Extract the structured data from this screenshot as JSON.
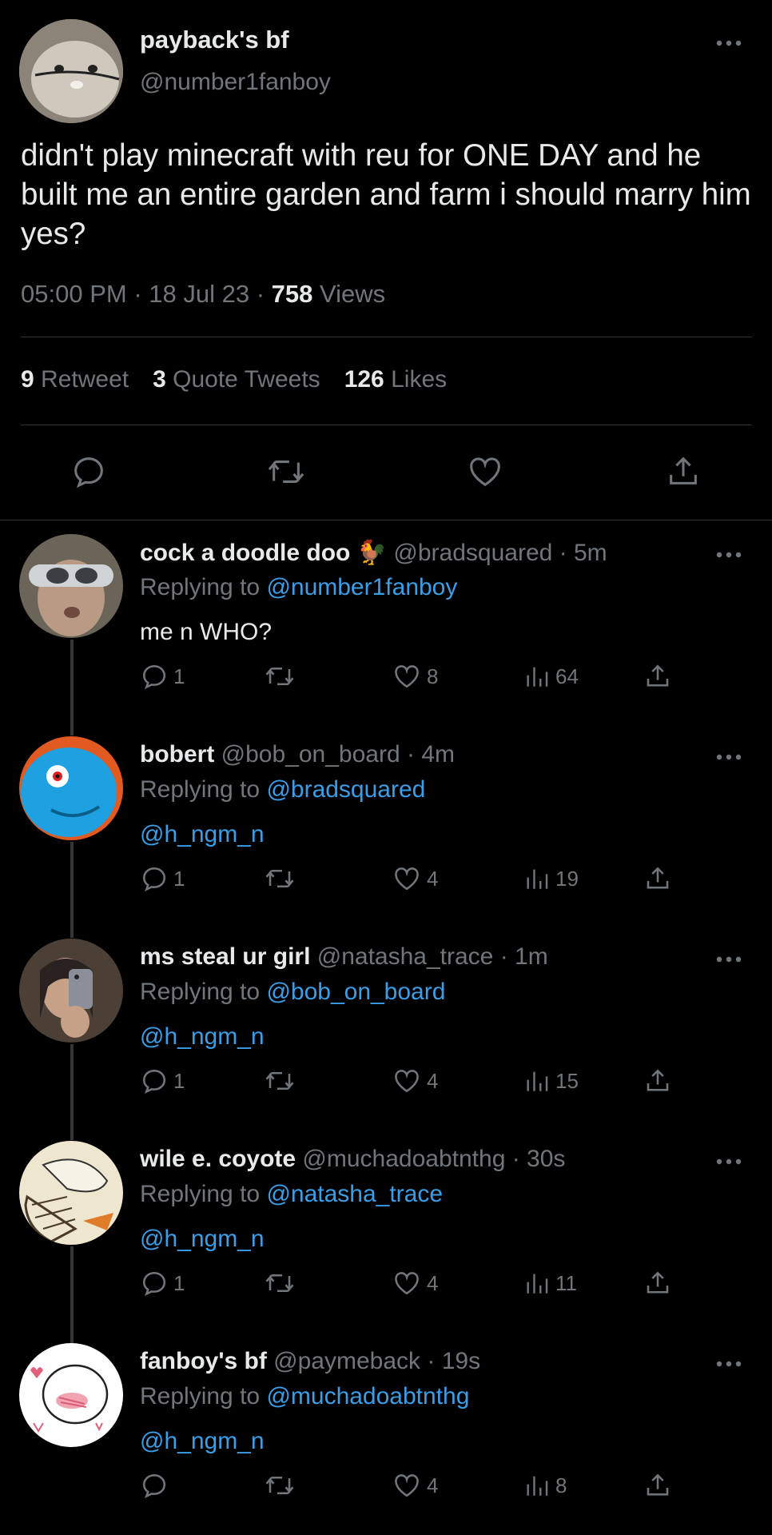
{
  "tweet": {
    "display_name": "payback's bf",
    "handle": "@number1fanboy",
    "text": "didn't play minecraft with reu for ONE DAY and he built me an entire garden and farm i should marry him yes?",
    "time": "05:00 PM",
    "date": "18 Jul 23",
    "views_count": "758",
    "views_label": "Views",
    "retweets_count": "9",
    "retweets_label": "Retweet",
    "quotes_count": "3",
    "quotes_label": "Quote Tweets",
    "likes_count": "126",
    "likes_label": "Likes"
  },
  "reply_prefix": "Replying to",
  "replies": [
    {
      "name": "cock a doodle doo 🐓",
      "handle": "@bradsquared",
      "time": "· 5m",
      "replying_to": "@number1fanboy",
      "text": "me n WHO?",
      "text_is_mention": false,
      "replies": "1",
      "likes": "8",
      "views": "64",
      "avatar_color": "#7a7060"
    },
    {
      "name": "bobert",
      "handle": "@bob_on_board",
      "time": "· 4m",
      "replying_to": "@bradsquared",
      "text": "@h_ngm_n",
      "text_is_mention": true,
      "replies": "1",
      "likes": "4",
      "views": "19",
      "avatar_color": "#1e95d8"
    },
    {
      "name": "ms steal ur girl",
      "handle": "@natasha_trace",
      "time": "· 1m",
      "replying_to": "@bob_on_board",
      "text": "@h_ngm_n",
      "text_is_mention": true,
      "replies": "1",
      "likes": "4",
      "views": "15",
      "avatar_color": "#5a4a40"
    },
    {
      "name": "wile e. coyote",
      "handle": "@muchadoabtnthg",
      "time": "· 30s",
      "replying_to": "@natasha_trace",
      "text": "@h_ngm_n",
      "text_is_mention": true,
      "replies": "1",
      "likes": "4",
      "views": "11",
      "avatar_color": "#efe6cf"
    },
    {
      "name": "fanboy's bf",
      "handle": "@paymeback",
      "time": "· 19s",
      "replying_to": "@muchadoabtnthg",
      "text": "@h_ngm_n",
      "text_is_mention": true,
      "replies": "",
      "likes": "4",
      "views": "8",
      "avatar_color": "#ffffff"
    }
  ],
  "icons": [
    "more-icon",
    "reply-icon",
    "retweet-icon",
    "like-icon",
    "share-icon",
    "views-icon"
  ],
  "colors": {
    "background": "#000000",
    "text": "#e7e9ea",
    "muted": "#71767b",
    "link": "#3a9ee8",
    "divider": "#2f3336"
  }
}
